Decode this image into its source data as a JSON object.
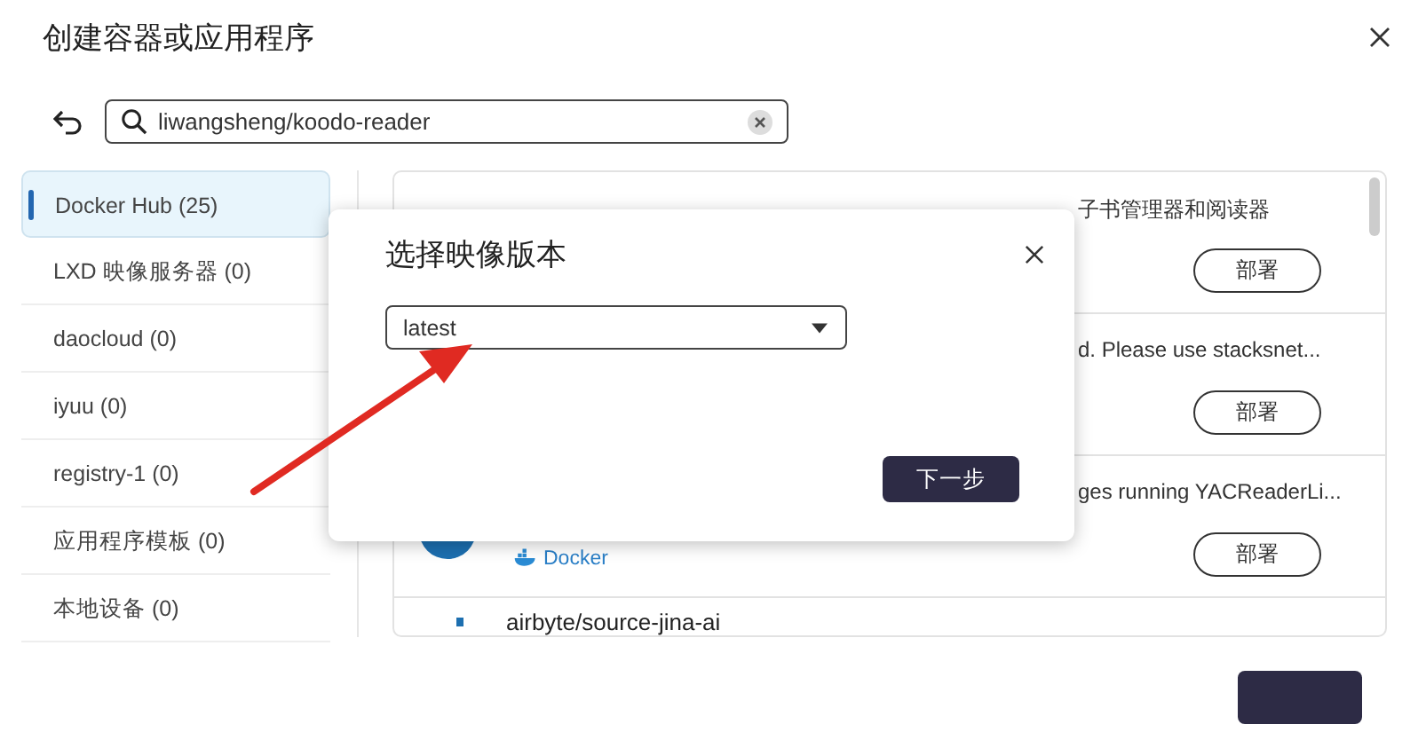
{
  "window": {
    "title": "创建容器或应用程序"
  },
  "search": {
    "value": "liwangsheng/koodo-reader"
  },
  "sources": [
    {
      "label": "Docker Hub (25)",
      "selected": true
    },
    {
      "label": "LXD 映像服务器 (0)",
      "selected": false
    },
    {
      "label": "daocloud (0)",
      "selected": false
    },
    {
      "label": "iyuu (0)",
      "selected": false
    },
    {
      "label": "registry-1 (0)",
      "selected": false
    },
    {
      "label": "应用程序模板 (0)",
      "selected": false
    },
    {
      "label": "本地设备 (0)",
      "selected": false
    }
  ],
  "results": [
    {
      "description": "子书管理器和阅读器",
      "action": "部署"
    },
    {
      "description": "d. Please use stacksnet...",
      "action": "部署"
    },
    {
      "description": "ges running YACReaderLi...",
      "action": "部署",
      "tag": "Docker"
    },
    {
      "name": "airbyte/source-jina-ai"
    }
  ],
  "dialog": {
    "title": "选择映像版本",
    "select_value": "latest",
    "next_button": "下一步"
  }
}
